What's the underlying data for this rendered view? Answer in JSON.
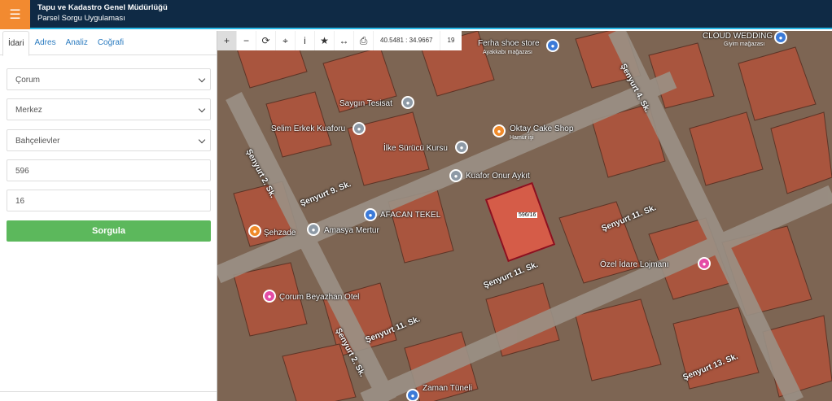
{
  "header": {
    "menu_icon": "hamburger-icon",
    "title": "Tapu ve Kadastro Genel Müdürlüğü",
    "subtitle": "Parsel Sorgu Uygulaması"
  },
  "sidebar": {
    "tabs": [
      {
        "label": "İdari",
        "active": true
      },
      {
        "label": "Adres",
        "active": false
      },
      {
        "label": "Analiz",
        "active": false
      },
      {
        "label": "Coğrafi",
        "active": false
      }
    ],
    "fields": {
      "il": "Çorum",
      "ilce": "Merkez",
      "mahalle": "Bahçelievler",
      "ada": "596",
      "parsel": "16"
    },
    "submit_label": "Sorgula"
  },
  "map": {
    "toolbar": {
      "icons": [
        "plus-icon",
        "minus-icon",
        "refresh-icon",
        "crosshair-icon",
        "info-icon",
        "star-icon",
        "measure-icon",
        "print-icon"
      ],
      "coordinates": "40.5481 : 34.9667",
      "zoom": "19"
    },
    "parcel_label": "596/16",
    "pois": [
      {
        "label": "Ferha shoe store",
        "sub": "Ayakkabı mağazası"
      },
      {
        "label": "CLOUD WEDDING",
        "sub": "Giyim mağazası"
      },
      {
        "label": "Saygın Tesisat"
      },
      {
        "label": "Selim Erkek Kuaforu"
      },
      {
        "label": "Oktay Cake Shop",
        "sub": "Hamur işi"
      },
      {
        "label": "İlke Sürücü Kursu"
      },
      {
        "label": "Kuafor Onur Aykıt"
      },
      {
        "label": "AFACAN TEKEL"
      },
      {
        "label": "Şehzade"
      },
      {
        "label": "Amasya Mertur"
      },
      {
        "label": "Özel İdare Lojmanı"
      },
      {
        "label": "Çorum Beyazhan Otel"
      },
      {
        "label": "Zaman Tüneli"
      }
    ],
    "streets": [
      "Şenyurt 2. Sk.",
      "Şenyurt 9. Sk.",
      "Şenyurt 4. Sk.",
      "Şenyurt 11. Sk.",
      "Şenyurt 11. Sk.",
      "Şenyurt 11. Sk.",
      "Şenyurt 2. Sk.",
      "Şenyurt 13. Sk."
    ]
  }
}
